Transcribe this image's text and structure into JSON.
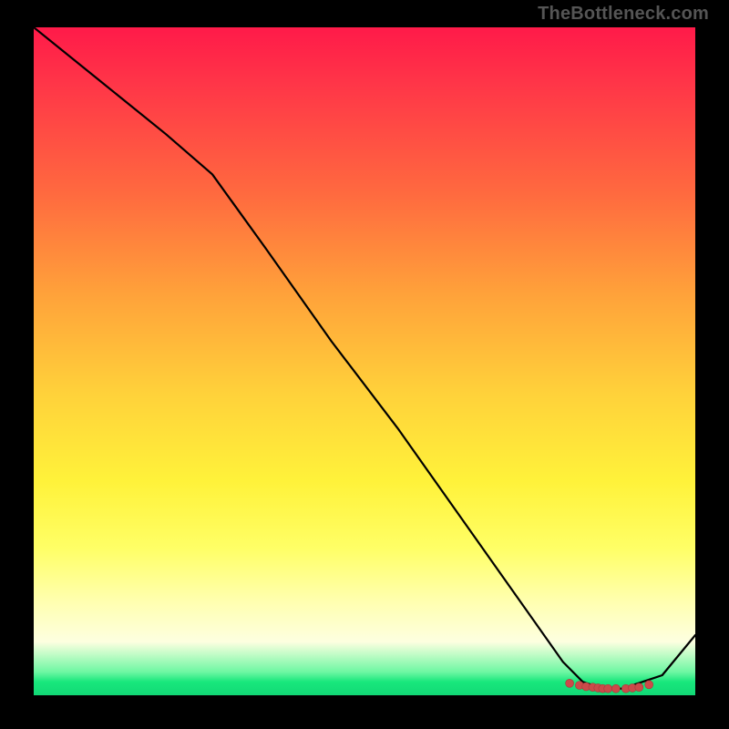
{
  "attribution": "TheBottleneck.com",
  "colors": {
    "background": "#000000",
    "curve": "#000000",
    "dots": "#cc4a4a",
    "gradient_top": "#ff1a49",
    "gradient_bottom": "#12d976"
  },
  "chart_data": {
    "type": "line",
    "title": "",
    "xlabel": "",
    "ylabel": "",
    "xlim": [
      0,
      100
    ],
    "ylim": [
      0,
      100
    ],
    "annotations": [
      "TheBottleneck.com"
    ],
    "grid": false,
    "legend": false,
    "notes": "No axis tick labels are shown; x and y are expressed on a 0–100 scale estimated from pixel position within the plot area. Lower y = closer to bottom (green band).",
    "series": [
      {
        "name": "curve",
        "style": "black-line",
        "x": [
          0,
          10,
          20,
          27,
          35,
          45,
          55,
          65,
          75,
          80,
          83,
          86,
          89,
          92,
          95,
          100
        ],
        "y": [
          100,
          92,
          84,
          78,
          67,
          53,
          40,
          26,
          12,
          5,
          2,
          1,
          1,
          2,
          3,
          9
        ]
      }
    ],
    "markers": {
      "name": "highlight-dots",
      "style": "red-dots",
      "x": [
        81,
        82.5,
        83.5,
        84.5,
        85.3,
        86,
        86.8,
        88,
        89.5,
        90.5,
        91.5,
        93
      ],
      "y": [
        1.8,
        1.5,
        1.3,
        1.2,
        1.1,
        1.0,
        1.0,
        1.0,
        1.0,
        1.1,
        1.2,
        1.6
      ]
    }
  }
}
